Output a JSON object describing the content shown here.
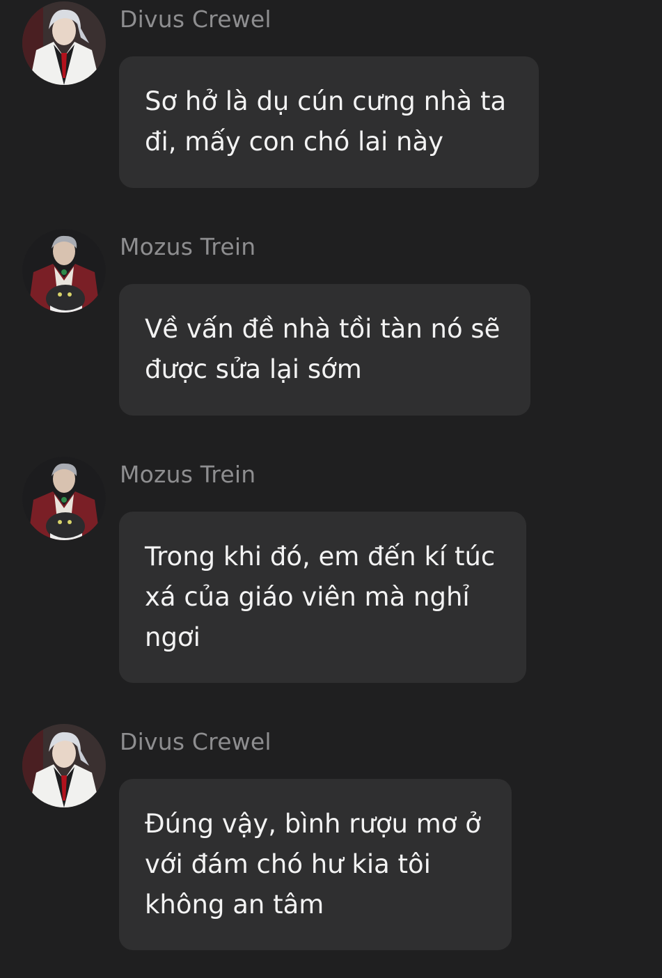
{
  "messages": [
    {
      "sender": "Divus Crewel",
      "avatar": "divus-crewel-avatar",
      "text": "Sơ hở là dụ cún cưng nhà ta\nđi, mấy con chó lai này"
    },
    {
      "sender": "Mozus Trein",
      "avatar": "mozus-trein-avatar",
      "text": "Về vấn đề nhà tồi tàn nó sẽ\nđược sửa lại sớm"
    },
    {
      "sender": "Mozus Trein",
      "avatar": "mozus-trein-avatar",
      "text": "Trong khi đó, em đến kí túc\nxá của giáo viên mà nghỉ\nngơi"
    },
    {
      "sender": "Divus Crewel",
      "avatar": "divus-crewel-avatar",
      "text": "Đúng vậy, bình rượu mơ ở\nvới đám chó hư kia tôi\nkhông an tâm"
    }
  ]
}
